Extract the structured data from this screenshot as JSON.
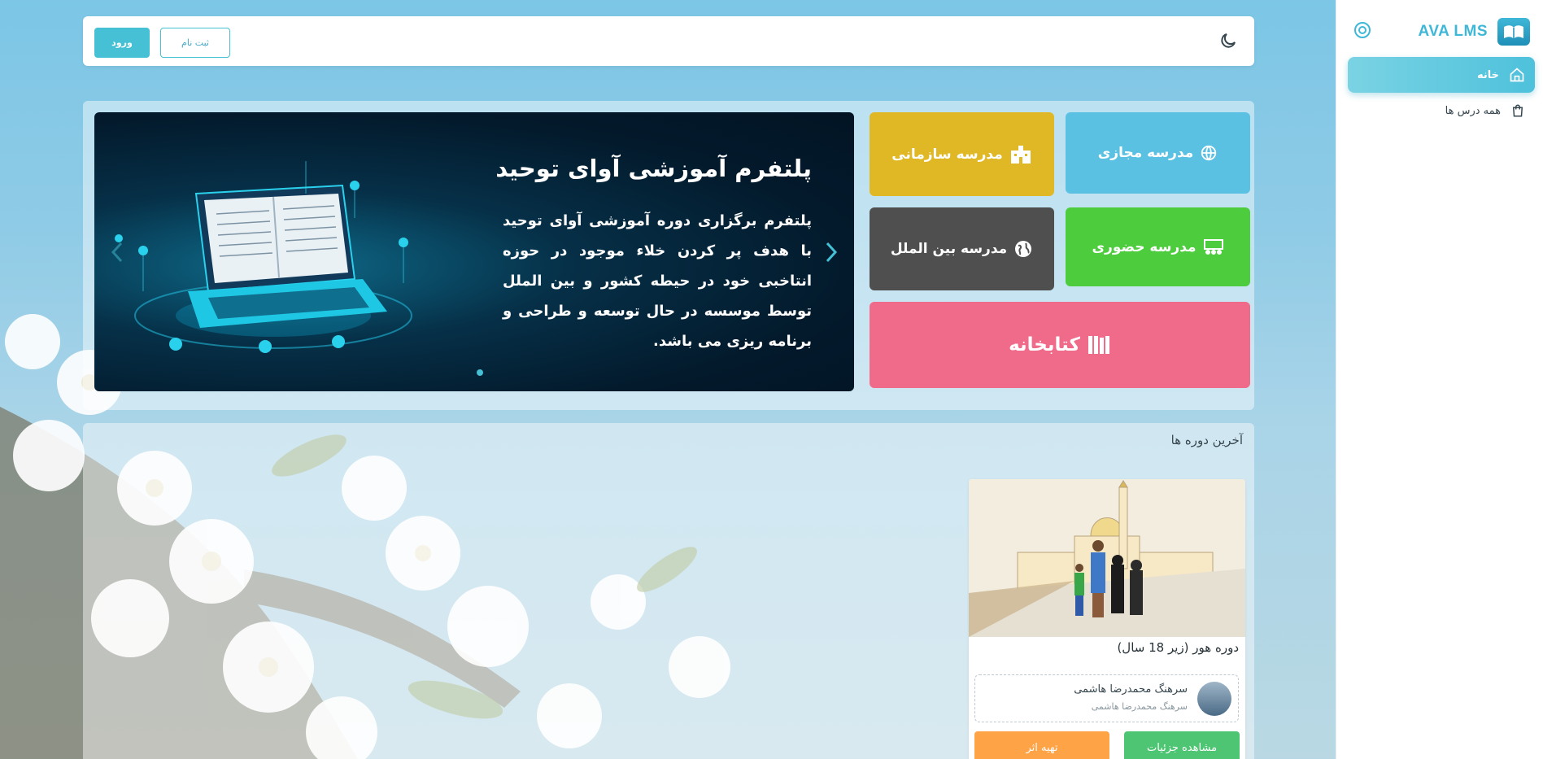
{
  "brand": {
    "name": "AVA LMS",
    "logo_icon": "book-logo-icon"
  },
  "sidebar": {
    "items": [
      {
        "label": "خانه",
        "icon": "home-icon",
        "active": true
      },
      {
        "label": "همه درس ها",
        "icon": "shopping-bag-icon",
        "active": false
      }
    ]
  },
  "topbar": {
    "login_label": "ورود",
    "register_label": "ثبت نام",
    "theme_icon": "moon-icon"
  },
  "hero": {
    "title": "پلتفرم آموزشی آوای توحید",
    "text": "پلتفرم برگزاری دوره آموزشی آوای توحید با هدف پر کردن خلاء موجود در حوزه انتاخبی خود در حیطه کشور و بین الملل توسط موسسه در حال توسعه و طراحی و برنامه ریزی می باشد."
  },
  "tiles": {
    "virtual": "مدرسه مجازی",
    "org": "مدرسه سازمانی",
    "presence": "مدرسه حضوری",
    "intl": "مدرسه بین الملل",
    "library": "کتابخانه"
  },
  "courses": {
    "title": "آخرین دوره ها",
    "items": [
      {
        "name": "دوره هور (زیر 18 سال)",
        "teacher": "سرهنگ محمدرضا هاشمی",
        "teacher_sub": "سرهنگ محمدرضا هاشمی",
        "details_label": "مشاهده جزئیات",
        "prepare_label": "تهیه اثر"
      }
    ]
  },
  "colors": {
    "accent": "#45c0d4",
    "virtual": "#5bc1e3",
    "org": "#e0b825",
    "presence": "#4dcd3d",
    "intl": "#4f4f4f",
    "library": "#f06a8a",
    "details": "#4ec572",
    "prepare": "#ffa347"
  }
}
